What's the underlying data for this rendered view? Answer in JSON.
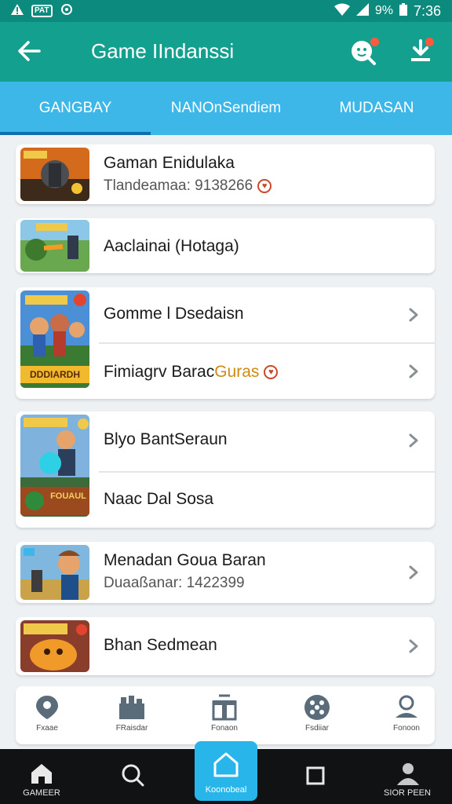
{
  "status_bar": {
    "icons": [
      "warning-icon",
      "sim-icon",
      "sync-icon"
    ],
    "sim_label": "PAT",
    "battery": "9%",
    "time": "7:36"
  },
  "app_bar": {
    "title": "Game IIndanssi",
    "back_icon": "arrow-left-icon",
    "search_icon": "search-icon",
    "download_icon": "download-icon"
  },
  "tabs": [
    {
      "label": "GANGBAY",
      "active": true
    },
    {
      "label": "NANOnSendiem",
      "active": false
    },
    {
      "label": "MUDASAN",
      "active": false
    }
  ],
  "items": [
    {
      "title": "Gaman Enidulaka",
      "subtitle": "Tlandeamaa: 9138266",
      "badge": "♥"
    },
    {
      "title": "Aaclainai (Hotaga)"
    },
    {
      "title": "Gomme l Dsedaisn",
      "thumb_label": "DDDIARDH"
    },
    {
      "title": "Fimiagrv Barac",
      "title_highlight": "Guras",
      "badge": "♥"
    },
    {
      "title": "Blyo BantSeraun",
      "thumb_label": "FOUAUL"
    },
    {
      "title": "Naac Dal Sosa"
    },
    {
      "title": "Menadan Goua Baran",
      "subtitle": "Duaaßanar: 1422399"
    },
    {
      "title": "Bhan Sedmean"
    }
  ],
  "sub_nav": [
    {
      "label": "Fxaae",
      "icon": "location-pin-icon"
    },
    {
      "label": "FRaisdar",
      "icon": "grid-blocks-icon"
    },
    {
      "label": "Fonaon",
      "icon": "gift-icon"
    },
    {
      "label": "Fsdiiar",
      "icon": "settings-dots-icon"
    },
    {
      "label": "Fonoon",
      "icon": "user-icon"
    }
  ],
  "bottom_nav": [
    {
      "label": "GAMEER",
      "icon": "home-icon"
    },
    {
      "label": "",
      "icon": "search-icon"
    },
    {
      "label": "Koonobeal",
      "icon": "home-outline-icon",
      "active": true
    },
    {
      "label": "",
      "icon": "square-icon"
    },
    {
      "label": "SIOR PEEN",
      "icon": "person-icon"
    }
  ],
  "colors": {
    "app_bar": "#14a08f",
    "tabs": "#3db6e8",
    "active_tab_indicator": "#0e6fb0",
    "bottom_nav": "#101214",
    "home_button": "#28b6ea"
  }
}
